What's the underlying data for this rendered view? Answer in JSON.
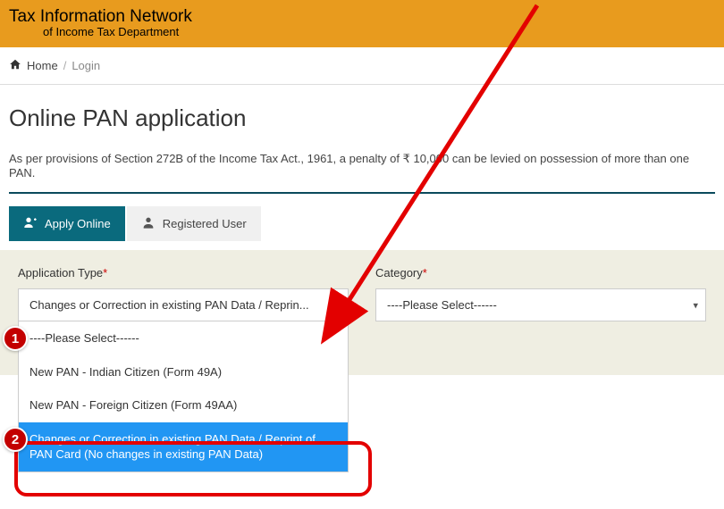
{
  "header": {
    "title": "Tax Information Network",
    "subtitle": "of Income Tax Department"
  },
  "breadcrumb": {
    "home": "Home",
    "current": "Login"
  },
  "page": {
    "title": "Online PAN application",
    "notice": "As per provisions of Section 272B of the Income Tax Act., 1961, a penalty of ₹ 10,000 can be levied on possession of more than one PAN."
  },
  "tabs": {
    "apply": "Apply Online",
    "registered": "Registered User"
  },
  "form": {
    "app_type_label": "Application Type",
    "category_label": "Category",
    "app_type_selected": "Changes or Correction in existing PAN Data / Reprin...",
    "category_selected": "----Please Select------",
    "app_type_options": [
      "----Please Select------",
      "New PAN - Indian Citizen (Form 49A)",
      "New PAN - Foreign Citizen (Form 49AA)",
      "Changes or Correction in existing PAN Data / Reprint of PAN Card (No changes in existing PAN Data)"
    ]
  },
  "annotations": {
    "bubble1": "1",
    "bubble2": "2"
  }
}
